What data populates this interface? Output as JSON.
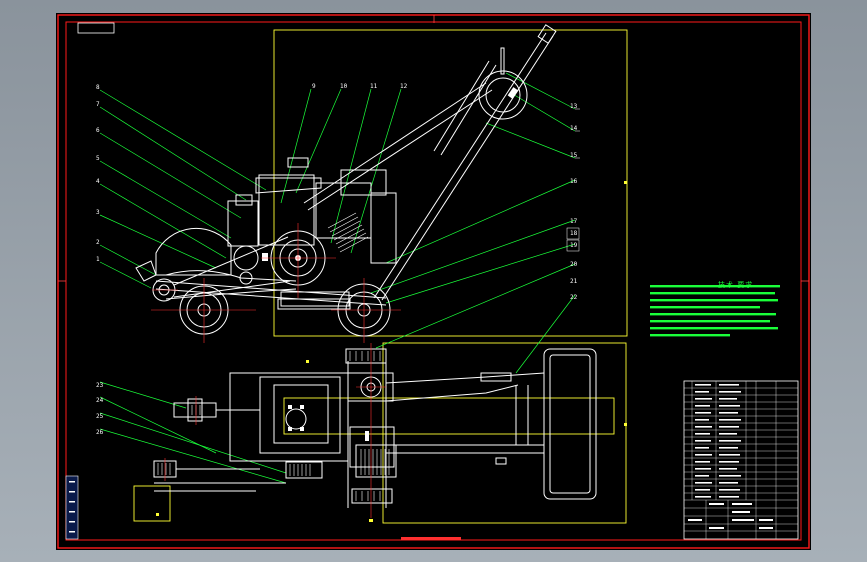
{
  "drawing": {
    "notes_title": "技术 要求",
    "callouts_left": [
      "8",
      "7",
      "6",
      "5",
      "4",
      "3",
      "2",
      "1"
    ],
    "callouts_top": [
      "9",
      "10",
      "11",
      "12"
    ],
    "callouts_right": [
      "13",
      "14",
      "15",
      "16",
      "17",
      "18",
      "19",
      "20",
      "21",
      "22"
    ],
    "callouts_bottom_left": [
      "23",
      "24",
      "25",
      "26"
    ],
    "colors": {
      "sheet": "#000000",
      "border": "#ff1a1a",
      "lines": "#ffffff",
      "leaders": "#1aff3a",
      "frames": "#ffff33",
      "centerlines": "#ff3030"
    }
  }
}
